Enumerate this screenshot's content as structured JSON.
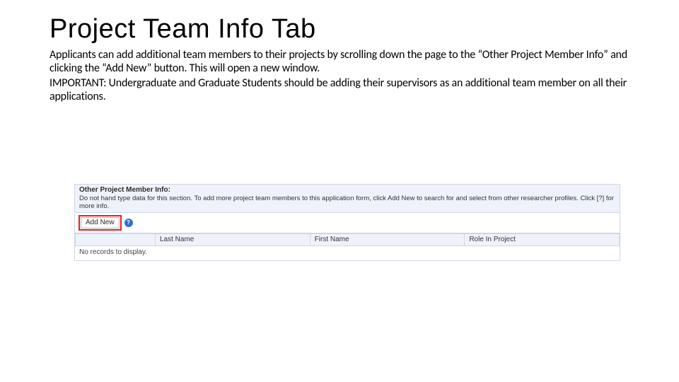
{
  "title": "Project Team Info Tab",
  "body": {
    "p1": "Applicants can add additional team members to their projects by scrolling down the page to the “Other Project Member Info” and clicking the “Add New” button. This will open a new window.",
    "p2": "IMPORTANT: Undergraduate and Graduate Students should be adding their supervisors as an additional team member on all their applications."
  },
  "panel": {
    "title": "Other Project Member Info:",
    "description": "Do not hand type data for this section. To add more project team members to this application form, click Add New to search for and select from other researcher profiles. Click [?] for more info.",
    "add_label": "Add New",
    "info_glyph": "?",
    "columns": {
      "c1": "",
      "c2": "Last Name",
      "c3": "First Name",
      "c4": "Role In Project"
    },
    "empty": "No records to display."
  }
}
